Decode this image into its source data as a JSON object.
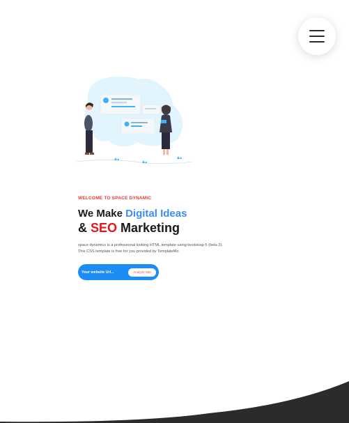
{
  "colors": {
    "accent_blue": "#3a8ef6",
    "accent_red": "#e8151a",
    "search_bg": "#1e8cf5",
    "footer_dark": "#2b2b2b"
  },
  "icons": {
    "menu": "hamburger-menu-icon"
  },
  "hero": {
    "eyebrow": "WELCOME TO SPACE DYNAMIC",
    "headline_line1_prefix": "We Make ",
    "headline_line1_accent": "Digital Ideas",
    "headline_line2_prefix": "& ",
    "headline_line2_accent": "SEO",
    "headline_line2_suffix": " Marketing",
    "description": "space dynamics is a professional looking HTML template using bootstrap 5 (beta 2). This CSS template is free for you provided by TemplateMo"
  },
  "search": {
    "placeholder": "Your website Url...",
    "button_label": "Analyze Site"
  }
}
